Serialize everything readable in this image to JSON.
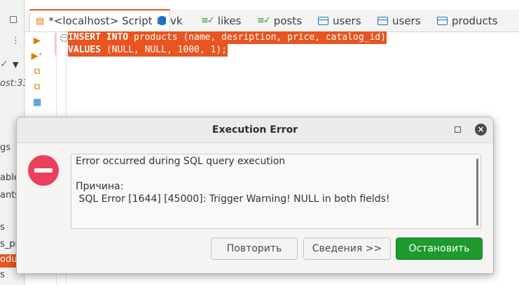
{
  "navigator": {
    "fragments": [
      "ost:33",
      "gs",
      "able",
      "ants",
      "s",
      "s_pr",
      "oducts",
      "s"
    ],
    "selected": "oducts"
  },
  "tabs": [
    {
      "label": "*<localhost> Script",
      "icon": "sql-script-icon",
      "active": true,
      "close": "⊠"
    },
    {
      "label": "vk",
      "icon": "database-icon"
    },
    {
      "label": "likes",
      "icon": "view-icon"
    },
    {
      "label": "posts",
      "icon": "view-icon"
    },
    {
      "label": "users",
      "icon": "table-icon"
    },
    {
      "label": "users",
      "icon": "table-icon"
    },
    {
      "label": "products",
      "icon": "table-icon"
    }
  ],
  "editor": {
    "lines": [
      {
        "kw": "INSERT INTO",
        "rest": " products (name, desription, price, catalog_id)"
      },
      {
        "kw": "VALUES",
        "rest": " (NULL, NULL, 1000, 1);"
      }
    ]
  },
  "dialog": {
    "title": "Execution Error",
    "message_lines": [
      "Error occurred during SQL query execution",
      "",
      "Причина:",
      " SQL Error [1644] [45000]: Trigger Warning! NULL in both fields!"
    ],
    "buttons": {
      "retry": "Повторить",
      "details": "Сведения >>",
      "stop": "Остановить"
    }
  },
  "colors": {
    "accent": "#e95420",
    "error_icon": "#ec3f5b",
    "primary_button": "#1e9a2f"
  }
}
